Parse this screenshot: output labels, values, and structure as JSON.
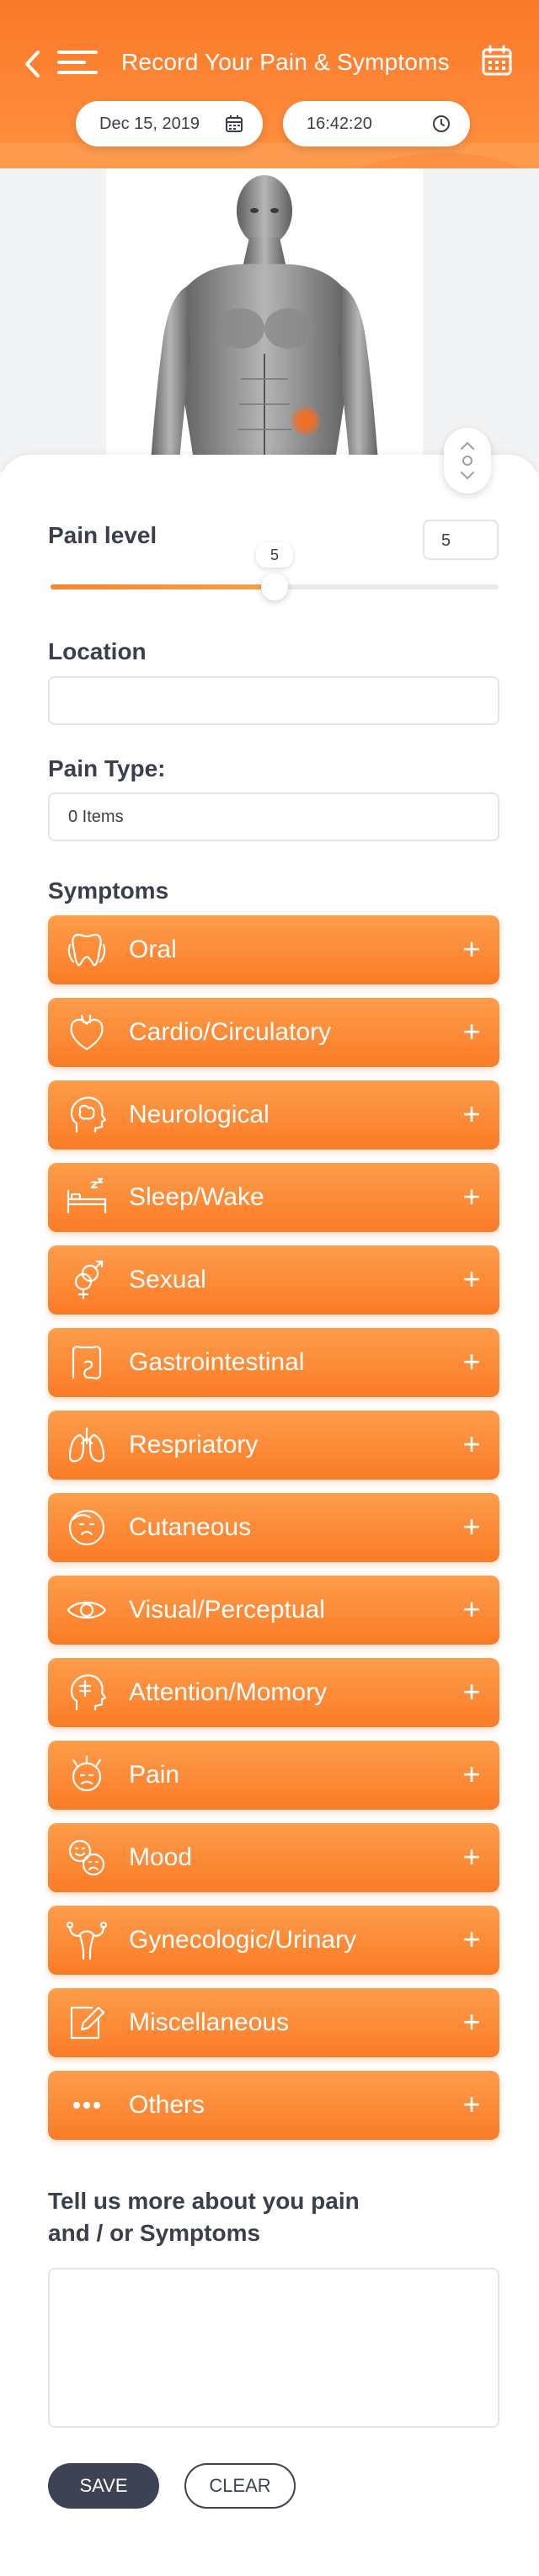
{
  "header": {
    "title": "Record Your Pain & Symptoms",
    "date": "Dec 15, 2019",
    "time": "16:42:20",
    "accent_color": "#fb7a2a"
  },
  "pain_level": {
    "label": "Pain level",
    "value": "5",
    "slider_value": 5,
    "slider_max": 10
  },
  "location": {
    "label": "Location",
    "value": ""
  },
  "pain_type": {
    "label": "Pain Type:",
    "value": "0 Items"
  },
  "symptoms": {
    "label": "Symptoms",
    "items": [
      {
        "label": "Oral",
        "icon": "tooth-icon"
      },
      {
        "label": "Cardio/Circulatory",
        "icon": "heart-icon"
      },
      {
        "label": "Neurological",
        "icon": "brain-head-icon"
      },
      {
        "label": "Sleep/Wake",
        "icon": "bed-icon"
      },
      {
        "label": "Sexual",
        "icon": "gender-icon"
      },
      {
        "label": "Gastrointestinal",
        "icon": "intestine-icon"
      },
      {
        "label": "Respriatory",
        "icon": "lungs-icon"
      },
      {
        "label": "Cutaneous",
        "icon": "face-icon"
      },
      {
        "label": "Visual/Perceptual",
        "icon": "eye-icon"
      },
      {
        "label": "Attention/Momory",
        "icon": "mind-icon"
      },
      {
        "label": "Pain",
        "icon": "pain-face-icon"
      },
      {
        "label": "Mood",
        "icon": "mood-icon"
      },
      {
        "label": "Gynecologic/Urinary",
        "icon": "uterus-icon"
      },
      {
        "label": "Miscellaneous",
        "icon": "edit-icon"
      },
      {
        "label": "Others",
        "icon": "more-icon"
      }
    ],
    "plus": "+"
  },
  "details": {
    "label_line1": "Tell us more about you pain",
    "label_line2": "and / or Symptoms",
    "value": ""
  },
  "actions": {
    "save": "SAVE",
    "clear": "CLEAR"
  }
}
